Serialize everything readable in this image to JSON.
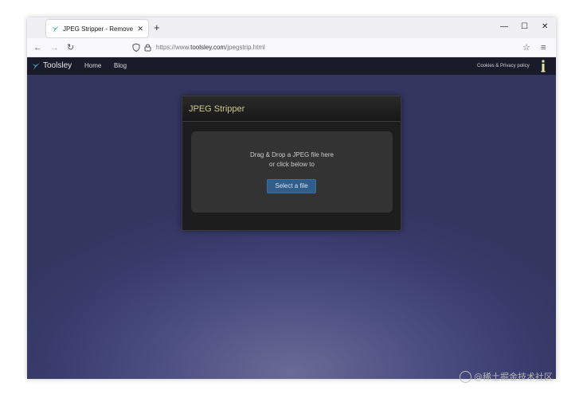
{
  "browser": {
    "tab": {
      "title": "JPEG Stripper - Remove metadata",
      "close_glyph": "✕",
      "favicon": "toolsley-bird-icon"
    },
    "new_tab_glyph": "+",
    "window_controls": {
      "minimize": "—",
      "maximize": "☐",
      "close": "✕"
    },
    "toolbar": {
      "back": "←",
      "forward": "→",
      "reload": "↻",
      "bookmark": "☆",
      "menu": "≡"
    },
    "url": {
      "prefix": "https://www.",
      "domain": "toolsley.com",
      "path": "/jpegstrip.html"
    }
  },
  "site": {
    "brand": "Toolsley",
    "nav": {
      "home": "Home",
      "blog": "Blog"
    },
    "cookies_link": "Cookies & Privacy policy",
    "accent_color": "#c9c98f"
  },
  "panel": {
    "title": "JPEG Stripper",
    "drop_line1": "Drag & Drop a JPEG file here",
    "drop_line2": "or click below to",
    "select_button": "Select a file"
  },
  "watermark": {
    "text": "@稀土掘金技术社区"
  }
}
